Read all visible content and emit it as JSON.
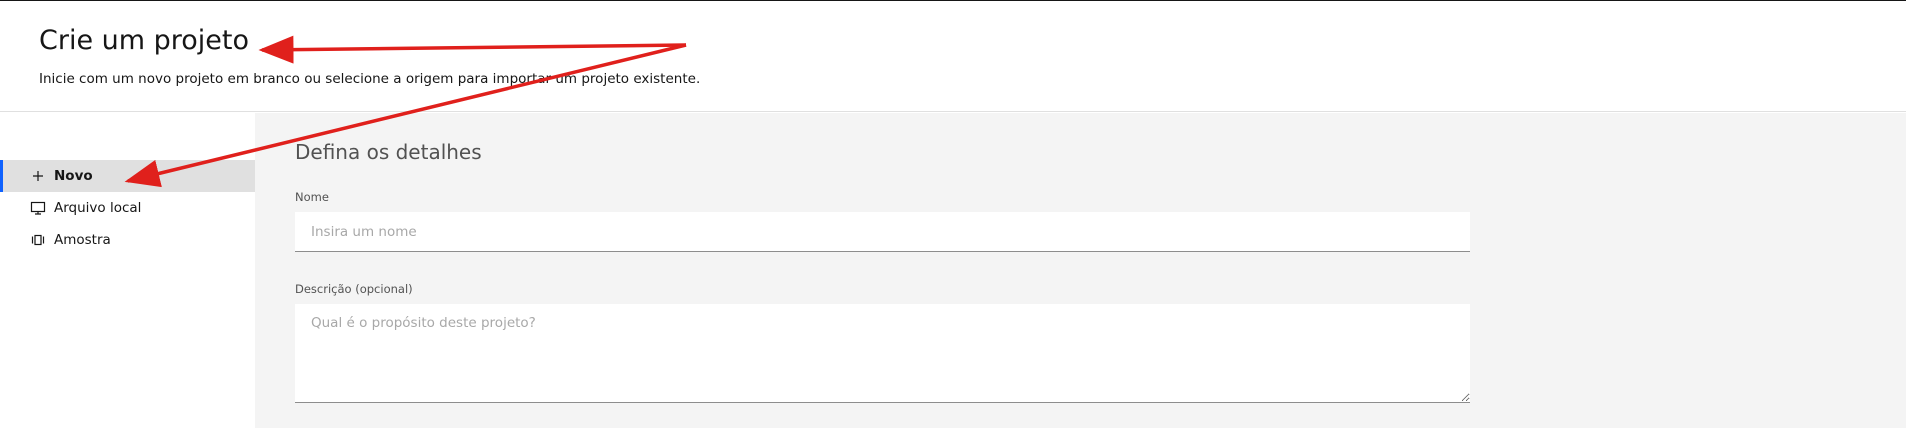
{
  "header": {
    "title": "Crie um projeto",
    "subtitle": "Inicie com um novo projeto em branco ou selecione a origem para importar um projeto existente."
  },
  "sidebar": {
    "items": [
      {
        "label": "Novo",
        "icon": "plus-icon",
        "active": true
      },
      {
        "label": "Arquivo local",
        "icon": "monitor-icon",
        "active": false
      },
      {
        "label": "Amostra",
        "icon": "sample-icon",
        "active": false
      }
    ]
  },
  "main": {
    "section_title": "Defina os detalhes",
    "name_field": {
      "label": "Nome",
      "placeholder": "Insira um nome",
      "value": ""
    },
    "description_field": {
      "label": "Descrição (opcional)",
      "placeholder": "Qual é o propósito deste projeto?",
      "value": ""
    }
  },
  "colors": {
    "accent": "#0f62fe",
    "annotation_arrow": "#e0201c",
    "content_background": "#f4f4f4",
    "active_item_background": "#e0e0e0"
  }
}
